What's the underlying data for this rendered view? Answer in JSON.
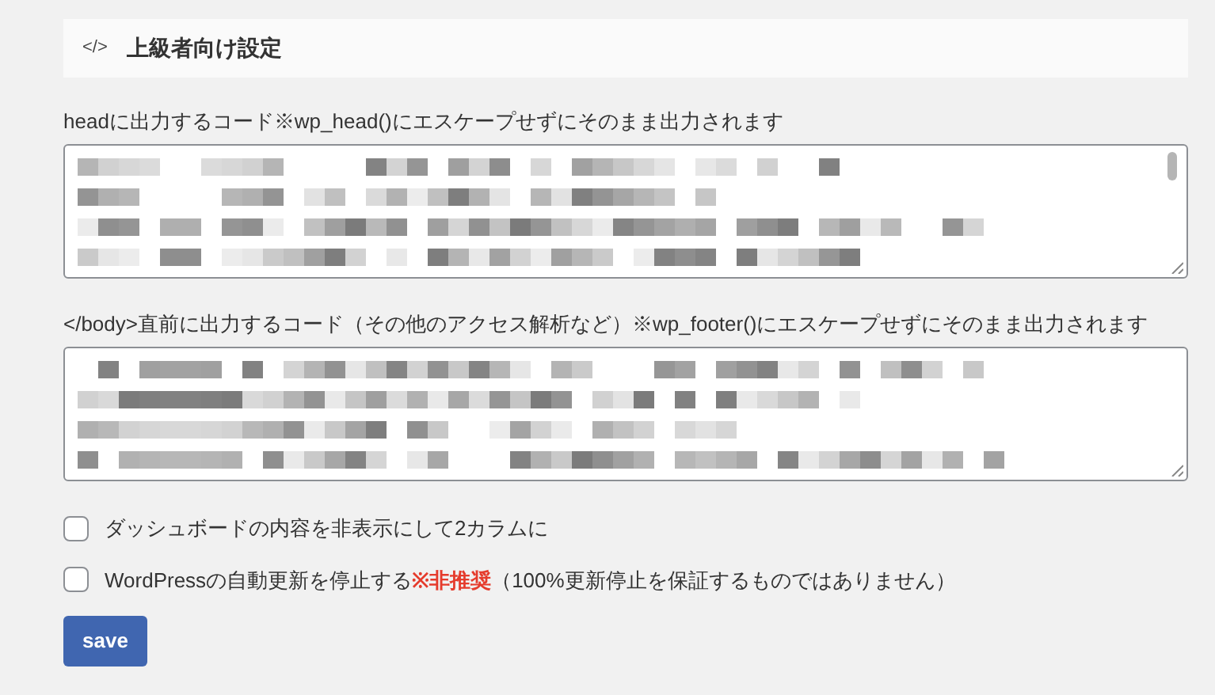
{
  "section": {
    "icon": "</>",
    "title": "上級者向け設定"
  },
  "code_fields": [
    {
      "label": "headに出力するコード",
      "note": "※wp_head()にエスケープせずにそのまま出力されます",
      "scrollbar": true
    },
    {
      "label": "</body>直前に出力するコード（その他のアクセス解析など）",
      "note": "※wp_footer()にエスケープせずにそのまま出力されます",
      "scrollbar": false
    }
  ],
  "checkboxes": [
    {
      "checked": false,
      "parts": [
        {
          "kind": "plain",
          "text": "ダッシュボードの内容を非表示にして2カラムに"
        }
      ]
    },
    {
      "checked": false,
      "parts": [
        {
          "kind": "plain",
          "text": "WordPressの自動更新を停止する"
        },
        {
          "kind": "warning",
          "text": "※非推奨"
        },
        {
          "kind": "plain",
          "text": "（100%更新停止を保証するものではありません）"
        }
      ]
    }
  ],
  "save_button": "save"
}
